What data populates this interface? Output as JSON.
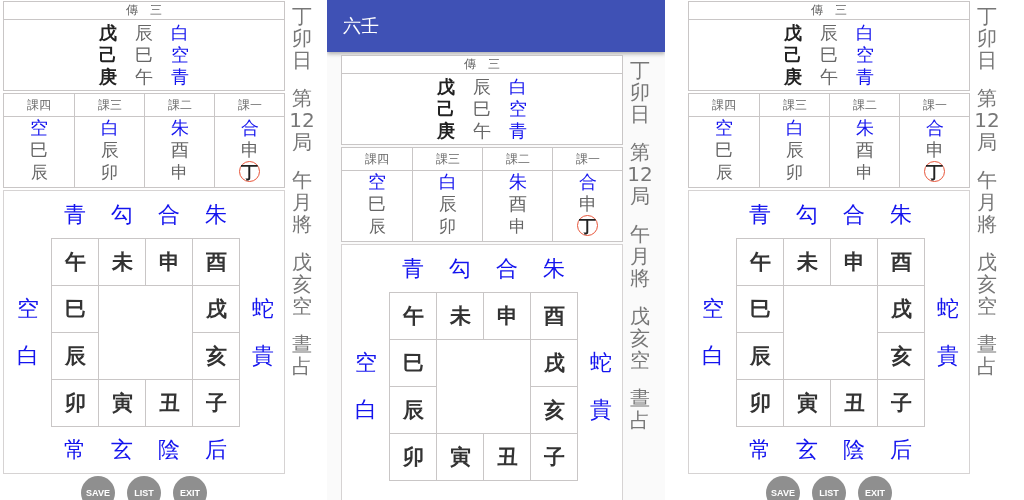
{
  "screens": [
    {
      "chuan": {
        "title": "傳　三",
        "rows": [
          {
            "stem": "戊",
            "branch": "辰",
            "god": "白"
          },
          {
            "stem": "己",
            "branch": "巳",
            "god": "空"
          },
          {
            "stem": "庚",
            "branch": "午",
            "god": "青"
          }
        ]
      },
      "lessons": [
        {
          "title": "課四",
          "god": "空",
          "upper": "巳",
          "lower": "辰",
          "circled": false
        },
        {
          "title": "課三",
          "god": "白",
          "upper": "辰",
          "lower": "卯",
          "circled": false
        },
        {
          "title": "課二",
          "god": "朱",
          "upper": "酉",
          "lower": "申",
          "circled": false
        },
        {
          "title": "課一",
          "god": "合",
          "upper": "申",
          "lower": "丁",
          "circled": true
        }
      ],
      "board": {
        "top_gods": [
          "青",
          "勾",
          "合",
          "朱"
        ],
        "left_gods": [
          "空",
          "白"
        ],
        "right_gods": [
          "蛇",
          "貴"
        ],
        "bottom_gods": [
          "常",
          "玄",
          "陰",
          "后"
        ],
        "top_row": [
          "午",
          "未",
          "申",
          "酉"
        ],
        "left_column": [
          "巳",
          "辰"
        ],
        "right_column": [
          "戌",
          "亥"
        ],
        "bottom_row": [
          "卯",
          "寅",
          "丑",
          "子"
        ]
      },
      "side": [
        "丁卯日",
        "第12局",
        "午月將",
        "戊亥空",
        "晝占"
      ],
      "buttons": [
        "SAVE",
        "LIST",
        "EXIT"
      ]
    },
    {
      "app_bar": "六壬",
      "chuan": {
        "title": "傳　三",
        "rows": [
          {
            "stem": "戊",
            "branch": "辰",
            "god": "白"
          },
          {
            "stem": "己",
            "branch": "巳",
            "god": "空"
          },
          {
            "stem": "庚",
            "branch": "午",
            "god": "青"
          }
        ]
      },
      "lessons": [
        {
          "title": "課四",
          "god": "空",
          "upper": "巳",
          "lower": "辰",
          "circled": false
        },
        {
          "title": "課三",
          "god": "白",
          "upper": "辰",
          "lower": "卯",
          "circled": false
        },
        {
          "title": "課二",
          "god": "朱",
          "upper": "酉",
          "lower": "申",
          "circled": false
        },
        {
          "title": "課一",
          "god": "合",
          "upper": "申",
          "lower": "丁",
          "circled": true
        }
      ],
      "board": {
        "top_gods": [
          "青",
          "勾",
          "合",
          "朱"
        ],
        "left_gods": [
          "空",
          "白"
        ],
        "right_gods": [
          "蛇",
          "貴"
        ],
        "top_row": [
          "午",
          "未",
          "申",
          "酉"
        ],
        "left_column": [
          "巳",
          "辰"
        ],
        "right_column": [
          "戌",
          "亥"
        ],
        "bottom_row": [
          "卯",
          "寅",
          "丑",
          "子"
        ]
      },
      "side": [
        "丁卯日",
        "第12局",
        "午月將",
        "戊亥空",
        "晝占"
      ]
    },
    {
      "chuan": {
        "title": "傳　三",
        "rows": [
          {
            "stem": "戊",
            "branch": "辰",
            "god": "白"
          },
          {
            "stem": "己",
            "branch": "巳",
            "god": "空"
          },
          {
            "stem": "庚",
            "branch": "午",
            "god": "青"
          }
        ]
      },
      "lessons": [
        {
          "title": "課四",
          "god": "空",
          "upper": "巳",
          "lower": "辰",
          "circled": false
        },
        {
          "title": "課三",
          "god": "白",
          "upper": "辰",
          "lower": "卯",
          "circled": false
        },
        {
          "title": "課二",
          "god": "朱",
          "upper": "酉",
          "lower": "申",
          "circled": false
        },
        {
          "title": "課一",
          "god": "合",
          "upper": "申",
          "lower": "丁",
          "circled": true
        }
      ],
      "board": {
        "top_gods": [
          "青",
          "勾",
          "合",
          "朱"
        ],
        "left_gods": [
          "空",
          "白"
        ],
        "right_gods": [
          "蛇",
          "貴"
        ],
        "bottom_gods": [
          "常",
          "玄",
          "陰",
          "后"
        ],
        "top_row": [
          "午",
          "未",
          "申",
          "酉"
        ],
        "left_column": [
          "巳",
          "辰"
        ],
        "right_column": [
          "戌",
          "亥"
        ],
        "bottom_row": [
          "卯",
          "寅",
          "丑",
          "子"
        ]
      },
      "side": [
        "丁卯日",
        "第12局",
        "午月將",
        "戊亥空",
        "晝占"
      ],
      "buttons": [
        "SAVE",
        "LIST",
        "EXIT"
      ]
    }
  ]
}
